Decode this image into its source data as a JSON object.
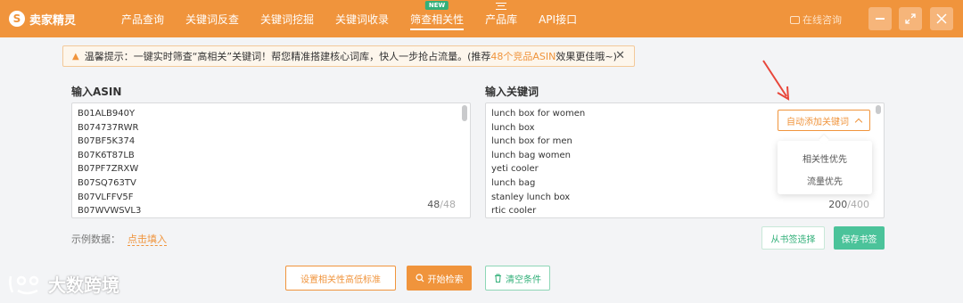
{
  "app": {
    "logo_letter": "S",
    "name": "卖家精灵"
  },
  "nav": {
    "items": [
      {
        "label": "产品查询"
      },
      {
        "label": "关键词反查"
      },
      {
        "label": "关键词挖掘"
      },
      {
        "label": "关键词收录"
      },
      {
        "label": "筛查相关性",
        "badge": "NEW",
        "active": true
      },
      {
        "label": "产品库"
      },
      {
        "label": "API接口"
      }
    ],
    "consult_label": "在线咨询"
  },
  "tip": {
    "prefix": "温馨提示：一键实时筛查“高相关”关键词！帮您精准搭建核心词库，快人一步抢占流量。(推荐",
    "highlight": "48个竞品ASIN",
    "suffix": "效果更佳哦~)"
  },
  "asin_panel": {
    "title": "输入ASIN",
    "lines": [
      "B01ALB940Y",
      "B074737RWR",
      "B07BF5K374",
      "B07K6T87LB",
      "B07PF7ZRXW",
      "B07SQ763TV",
      "B07VLFFV5F",
      "B07WVWSVL3"
    ],
    "count": "48",
    "max": "/48"
  },
  "keyword_panel": {
    "title": "输入关键词",
    "lines": [
      "lunch box for women",
      "lunch box",
      "lunch box for men",
      "lunch bag women",
      "yeti cooler",
      "lunch bag",
      "stanley lunch box",
      "rtic cooler"
    ],
    "count": "200",
    "max": "/400",
    "auto_add_label": "自动添加关键词",
    "dropdown_options": [
      "相关性优先",
      "流量优先"
    ]
  },
  "example": {
    "label": "示例数据：",
    "link": "点击填入"
  },
  "bookmark": {
    "select_label": "从书签选择",
    "save_label": "保存书签"
  },
  "actions": {
    "threshold_label": "设置相关性高低标准",
    "search_label": "开始检索",
    "clear_label": "清空条件"
  },
  "watermark": {
    "text": "大数跨境"
  },
  "colors": {
    "brand": "#f0943c",
    "green": "#33b07a",
    "arrow": "#e8463a"
  }
}
